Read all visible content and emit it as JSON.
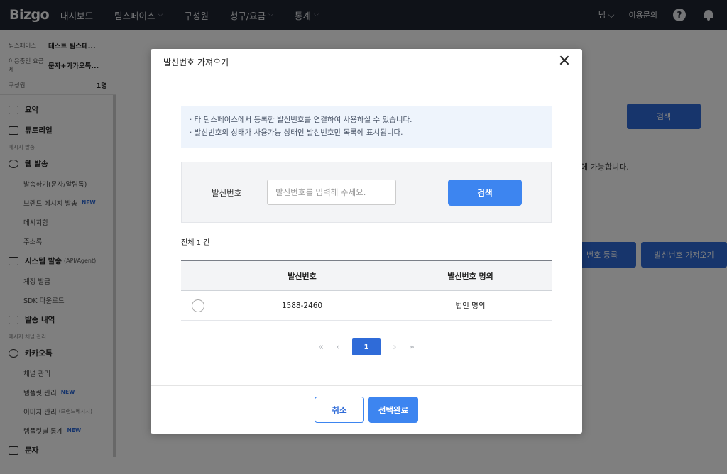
{
  "app": {
    "logo": "Bizgo",
    "nav": [
      {
        "label": "대시보드"
      },
      {
        "label": "팀스페이스"
      },
      {
        "label": "구성원"
      },
      {
        "label": "청구/요금"
      },
      {
        "label": "통계"
      }
    ],
    "user": "님 ⌵",
    "help_link": "이용문의",
    "help_icon": "?"
  },
  "sidebar": {
    "team_key": "팀스페이스",
    "team_val": "테스트 팀스페...",
    "plan_key": "이용중인 요금제",
    "plan_val": "문자+카카오톡...",
    "member_key": "구성원",
    "member_val": "1명",
    "items": {
      "summary": "요약",
      "tutorial": "튜토리얼",
      "section_send": "메시지 발송",
      "web_send": "웹 발송",
      "send_msg": "발송하기(문자/알림톡)",
      "brand_send": "브랜드 메시지 발송",
      "new": "NEW",
      "templates": "메시지함",
      "addressbook": "주소록",
      "system_send": "시스템 발송",
      "system_note": "(API/Agent)",
      "account": "계정 발급",
      "sdk": "SDK 다운로드",
      "history": "발송 내역",
      "section_channel": "메시지 채널 관리",
      "kakao": "카카오톡",
      "channel": "채널 관리",
      "template_mgmt": "템플릿 관리",
      "image_mgmt": "이미지 관리",
      "image_note": "(브랜드메시지)",
      "template_stats": "템플릿별 통계",
      "sms": "문자"
    }
  },
  "background": {
    "search_btn": "검색",
    "hint": "에 가능합니다.",
    "register_btn": "번호 등록",
    "import_btn": "발신번호 가져오기"
  },
  "modal": {
    "title": "발신번호 가져오기",
    "notice": [
      "· 타 팀스페이스에서 등록한 발신번호를 연결하여 사용하실 수 있습니다.",
      "· 발신번호의 상태가 사용가능 상태인 발신번호만 목록에 표시됩니다."
    ],
    "search_label": "발신번호",
    "search_placeholder": "발신번호를 입력해 주세요.",
    "search_button": "검색",
    "total_prefix": "전체",
    "total_count": "1",
    "total_suffix": "건",
    "table": {
      "headers": [
        "발신번호",
        "발신번호 명의"
      ],
      "rows": [
        {
          "number": "1588-2460",
          "owner": "법인 명의"
        }
      ]
    },
    "pager": {
      "first": "«",
      "prev": "‹",
      "current": "1",
      "next": "›",
      "last": "»"
    },
    "cancel": "취소",
    "confirm": "선택완료"
  },
  "colors": {
    "primary": "#3d85f0",
    "topbar": "#1f2530",
    "notice_bg": "#eef4fc"
  }
}
